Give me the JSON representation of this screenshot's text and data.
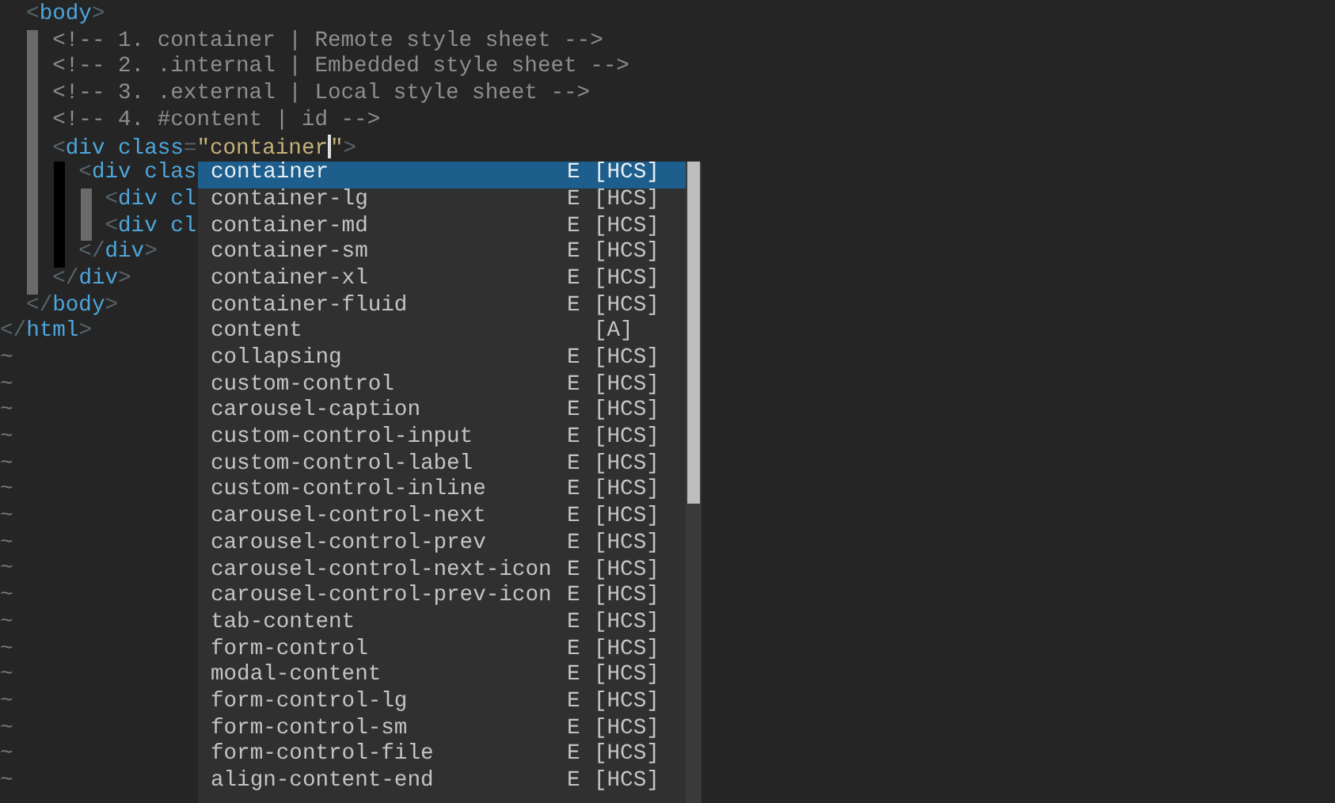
{
  "editor": {
    "lines": [
      {
        "tokens": [
          {
            "kind": "bracket",
            "text": "  <"
          },
          {
            "kind": "tag",
            "text": "body"
          },
          {
            "kind": "bracket",
            "text": ">"
          }
        ]
      },
      {
        "tokens": [
          {
            "kind": "comment",
            "text": "    <!-- 1. container | Remote style sheet -->"
          }
        ]
      },
      {
        "tokens": [
          {
            "kind": "comment",
            "text": "    <!-- 2. .internal | Embedded style sheet -->"
          }
        ]
      },
      {
        "tokens": [
          {
            "kind": "comment",
            "text": "    <!-- 3. .external | Local style sheet -->"
          }
        ]
      },
      {
        "tokens": [
          {
            "kind": "comment",
            "text": "    <!-- 4. #content | id -->"
          }
        ]
      },
      {
        "tokens": [
          {
            "kind": "bracket",
            "text": "    <"
          },
          {
            "kind": "tag",
            "text": "div"
          },
          {
            "kind": "attr",
            "text": " class"
          },
          {
            "kind": "bracket",
            "text": "="
          },
          {
            "kind": "string",
            "text": "\"container"
          },
          {
            "kind": "cursor"
          },
          {
            "kind": "string",
            "text": "\""
          },
          {
            "kind": "bracket",
            "text": ">"
          }
        ]
      },
      {
        "tokens": [
          {
            "kind": "bracket",
            "text": "      <"
          },
          {
            "kind": "tag",
            "text": "div"
          },
          {
            "kind": "attr",
            "text": " clas"
          }
        ]
      },
      {
        "tokens": [
          {
            "kind": "bracket",
            "text": "        <"
          },
          {
            "kind": "tag",
            "text": "div"
          },
          {
            "kind": "attr",
            "text": " cl"
          }
        ]
      },
      {
        "tokens": [
          {
            "kind": "bracket",
            "text": "        <"
          },
          {
            "kind": "tag",
            "text": "div"
          },
          {
            "kind": "attr",
            "text": " cl"
          }
        ]
      },
      {
        "tokens": [
          {
            "kind": "bracket",
            "text": "      </"
          },
          {
            "kind": "tag",
            "text": "div"
          },
          {
            "kind": "bracket",
            "text": ">"
          }
        ]
      },
      {
        "tokens": [
          {
            "kind": "bracket",
            "text": "    </"
          },
          {
            "kind": "tag",
            "text": "div"
          },
          {
            "kind": "bracket",
            "text": ">"
          }
        ]
      },
      {
        "tokens": [
          {
            "kind": "bracket",
            "text": "  </"
          },
          {
            "kind": "tag",
            "text": "body"
          },
          {
            "kind": "bracket",
            "text": ">"
          }
        ]
      },
      {
        "tokens": [
          {
            "kind": "bracket",
            "text": "</"
          },
          {
            "kind": "tag",
            "text": "html"
          },
          {
            "kind": "bracket",
            "text": ">"
          }
        ]
      }
    ],
    "filler": [
      "~",
      "~",
      "~",
      "~",
      "~",
      "~",
      "~",
      "~",
      "~",
      "~",
      "~",
      "~",
      "~",
      "~",
      "~",
      "~",
      "~"
    ]
  },
  "completion": {
    "items": [
      {
        "word": "container",
        "type": "E",
        "menu": "[HCS]",
        "selected": true
      },
      {
        "word": "container-lg",
        "type": "E",
        "menu": "[HCS]",
        "selected": false
      },
      {
        "word": "container-md",
        "type": "E",
        "menu": "[HCS]",
        "selected": false
      },
      {
        "word": "container-sm",
        "type": "E",
        "menu": "[HCS]",
        "selected": false
      },
      {
        "word": "container-xl",
        "type": "E",
        "menu": "[HCS]",
        "selected": false
      },
      {
        "word": "container-fluid",
        "type": "E",
        "menu": "[HCS]",
        "selected": false
      },
      {
        "word": "content",
        "menu": "[A]",
        "selected": false
      },
      {
        "word": "collapsing",
        "type": "E",
        "menu": "[HCS]",
        "selected": false
      },
      {
        "word": "custom-control",
        "type": "E",
        "menu": "[HCS]",
        "selected": false
      },
      {
        "word": "carousel-caption",
        "type": "E",
        "menu": "[HCS]",
        "selected": false
      },
      {
        "word": "custom-control-input",
        "type": "E",
        "menu": "[HCS]",
        "selected": false
      },
      {
        "word": "custom-control-label",
        "type": "E",
        "menu": "[HCS]",
        "selected": false
      },
      {
        "word": "custom-control-inline",
        "type": "E",
        "menu": "[HCS]",
        "selected": false
      },
      {
        "word": "carousel-control-next",
        "type": "E",
        "menu": "[HCS]",
        "selected": false
      },
      {
        "word": "carousel-control-prev",
        "type": "E",
        "menu": "[HCS]",
        "selected": false
      },
      {
        "word": "carousel-control-next-icon",
        "type": "E",
        "menu": "[HCS]",
        "selected": false
      },
      {
        "word": "carousel-control-prev-icon",
        "type": "E",
        "menu": "[HCS]",
        "selected": false
      },
      {
        "word": "tab-content",
        "type": "E",
        "menu": "[HCS]",
        "selected": false
      },
      {
        "word": "form-control",
        "type": "E",
        "menu": "[HCS]",
        "selected": false
      },
      {
        "word": "modal-content",
        "type": "E",
        "menu": "[HCS]",
        "selected": false
      },
      {
        "word": "form-control-lg",
        "type": "E",
        "menu": "[HCS]",
        "selected": false
      },
      {
        "word": "form-control-sm",
        "type": "E",
        "menu": "[HCS]",
        "selected": false
      },
      {
        "word": "form-control-file",
        "type": "E",
        "menu": "[HCS]",
        "selected": false
      },
      {
        "word": "align-content-end",
        "type": "E",
        "menu": "[HCS]",
        "selected": false
      }
    ]
  }
}
